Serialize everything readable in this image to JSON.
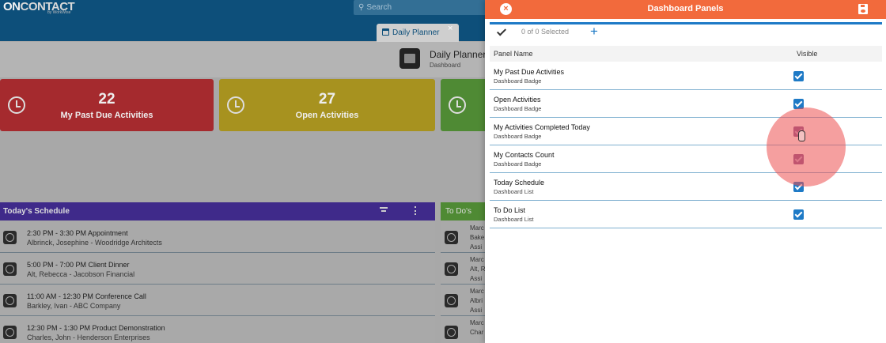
{
  "app": {
    "logo": {
      "main": "ON",
      "rest": "CONTACT",
      "sub": "by WorkWise"
    },
    "search_placeholder": "Search",
    "tab": {
      "label": "Daily Planner",
      "close": "×"
    },
    "header": {
      "title": "Daily Planner",
      "subtitle": "Dashboard"
    },
    "badges": [
      {
        "count": "22",
        "label": "My Past Due Activities",
        "color": "#a52a2e"
      },
      {
        "count": "27",
        "label": "Open Activities",
        "color": "#a7921f"
      },
      {
        "count": "",
        "label": "",
        "color": "#4f8a34"
      }
    ],
    "schedule": {
      "title": "Today's Schedule",
      "rows": [
        {
          "line1": "2:30 PM - 3:30 PM Appointment",
          "line2": "Albrinck, Josephine  - Woodridge Architects"
        },
        {
          "line1": "5:00 PM - 7:00 PM Client Dinner",
          "line2": "Alt, Rebecca  - Jacobson Financial"
        },
        {
          "line1": "11:00 AM - 12:30 PM Conference Call",
          "line2": "Barkley, Ivan  - ABC Company"
        },
        {
          "line1": "12:30 PM - 1:30 PM Product Demonstration",
          "line2": "Charles, John  - Henderson Enterprises"
        }
      ]
    },
    "todos": {
      "title": "To Do's",
      "rows": [
        {
          "a": "Marc",
          "b": "Bake",
          "c": "Assi"
        },
        {
          "a": "Marc",
          "b": "Alt, R",
          "c": "Assi"
        },
        {
          "a": "Marc",
          "b": "Albri",
          "c": "Assi"
        },
        {
          "a": "Marc",
          "b": "Char",
          "c": ""
        }
      ]
    }
  },
  "dialog": {
    "title": "Dashboard Panels",
    "close_glyph": "×",
    "selection_text": "0 of 0 Selected",
    "add_glyph": "+",
    "columns": {
      "name": "Panel Name",
      "visible": "Visible"
    },
    "panels": [
      {
        "name": "My Past Due Activities",
        "type": "Dashboard Badge",
        "visible": true
      },
      {
        "name": "Open Activities",
        "type": "Dashboard Badge",
        "visible": true
      },
      {
        "name": "My Activities Completed Today",
        "type": "Dashboard Badge",
        "visible": true
      },
      {
        "name": "My Contacts Count",
        "type": "Dashboard Badge",
        "visible": true
      },
      {
        "name": "Today Schedule",
        "type": "Dashboard List",
        "visible": true
      },
      {
        "name": "To Do List",
        "type": "Dashboard List",
        "visible": true
      }
    ],
    "accent_color": "#f26a3c",
    "checkbox_color": "#1e7ac6"
  }
}
